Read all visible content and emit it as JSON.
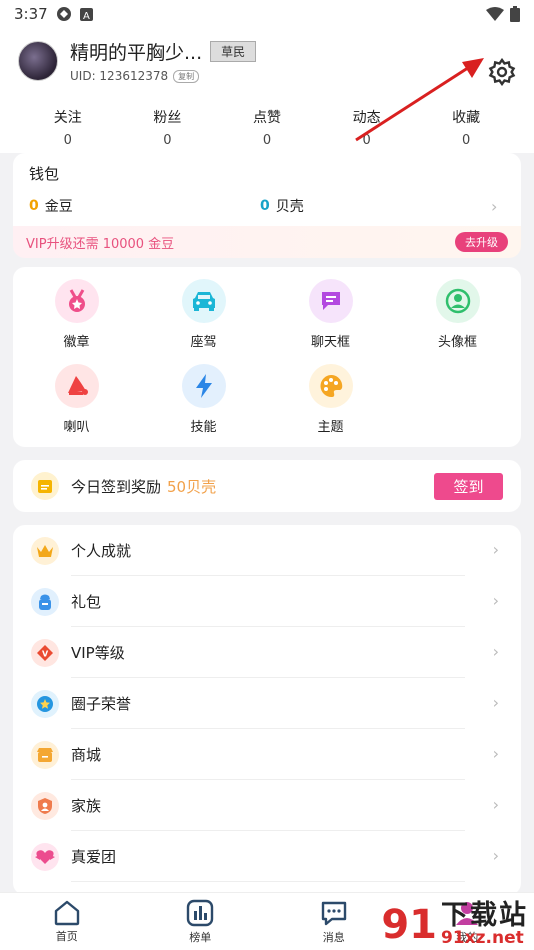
{
  "status_bar": {
    "time": "3:37"
  },
  "profile": {
    "name": "精明的平胸少...",
    "rank": "草民",
    "uid": "UID: 123612378",
    "copy_label": "复制"
  },
  "stats": [
    {
      "label": "关注",
      "value": "0"
    },
    {
      "label": "粉丝",
      "value": "0"
    },
    {
      "label": "点赞",
      "value": "0"
    },
    {
      "label": "动态",
      "value": "0"
    },
    {
      "label": "收藏",
      "value": "0"
    }
  ],
  "wallet": {
    "title": "钱包",
    "gold_value": "0",
    "gold_label": "金豆",
    "shell_value": "0",
    "shell_label": "贝壳",
    "vip_text": "VIP升级还需 10000 金豆",
    "upgrade_label": "去升级"
  },
  "features": [
    {
      "label": "徽章",
      "icon": "medal-icon",
      "bg": "#ffe4ef",
      "color": "#ef4f8a"
    },
    {
      "label": "座驾",
      "icon": "car-icon",
      "bg": "#e1f6fb",
      "color": "#1bb6d6"
    },
    {
      "label": "聊天框",
      "icon": "chat-frame-icon",
      "bg": "#f6e4fb",
      "color": "#b349e0"
    },
    {
      "label": "头像框",
      "icon": "avatar-frame-icon",
      "bg": "#e2f7ea",
      "color": "#2fbf6c"
    },
    {
      "label": "喇叭",
      "icon": "horn-icon",
      "bg": "#ffe5e5",
      "color": "#ef4242"
    },
    {
      "label": "技能",
      "icon": "lightning-icon",
      "bg": "#e3f0fd",
      "color": "#2b86e6"
    },
    {
      "label": "主题",
      "icon": "palette-icon",
      "bg": "#fff3dc",
      "color": "#f5a623"
    }
  ],
  "signin": {
    "text": "今日签到奖励",
    "reward": "50贝壳",
    "button": "签到"
  },
  "menu": [
    {
      "label": "个人成就",
      "icon": "crown-icon",
      "bg": "#fff1d6",
      "color": "#f3a81a"
    },
    {
      "label": "礼包",
      "icon": "gift-bag-icon",
      "bg": "#e1f0fd",
      "color": "#3a92e8"
    },
    {
      "label": "VIP等级",
      "icon": "vip-icon",
      "bg": "#ffe6e1",
      "color": "#ea4b32"
    },
    {
      "label": "圈子荣誉",
      "icon": "honor-icon",
      "bg": "#e0f2fd",
      "color": "#2596e0"
    },
    {
      "label": "商城",
      "icon": "shop-icon",
      "bg": "#fff0d6",
      "color": "#f4a732"
    },
    {
      "label": "家族",
      "icon": "family-icon",
      "bg": "#ffe9e0",
      "color": "#ef7b4d"
    },
    {
      "label": "真爱团",
      "icon": "love-group-icon",
      "bg": "#ffe4ef",
      "color": "#ec4c8e"
    }
  ],
  "tabs": [
    {
      "label": "首页",
      "icon": "home-icon"
    },
    {
      "label": "榜单",
      "icon": "ranking-icon"
    },
    {
      "label": "消息",
      "icon": "message-icon"
    },
    {
      "label": "我的",
      "icon": "profile-icon"
    }
  ],
  "watermark": {
    "big": "91",
    "cn": "下载站",
    "url": "91xz.net"
  }
}
